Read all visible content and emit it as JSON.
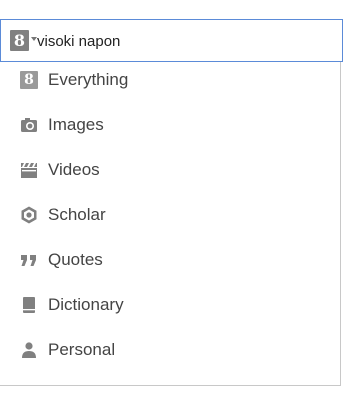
{
  "search": {
    "engine_glyph": "8",
    "query": "visoki napon"
  },
  "menu": {
    "items": [
      {
        "label": "Everything",
        "icon": "everything-icon",
        "glyph": "8"
      },
      {
        "label": "Images",
        "icon": "camera-icon"
      },
      {
        "label": "Videos",
        "icon": "clapperboard-icon"
      },
      {
        "label": "Scholar",
        "icon": "scholar-icon"
      },
      {
        "label": "Quotes",
        "icon": "quote-icon"
      },
      {
        "label": "Dictionary",
        "icon": "book-icon"
      },
      {
        "label": "Personal",
        "icon": "person-icon"
      }
    ]
  },
  "colors": {
    "border_focus": "#5b8bd8",
    "icon_gray": "#808080",
    "text": "#444444"
  }
}
